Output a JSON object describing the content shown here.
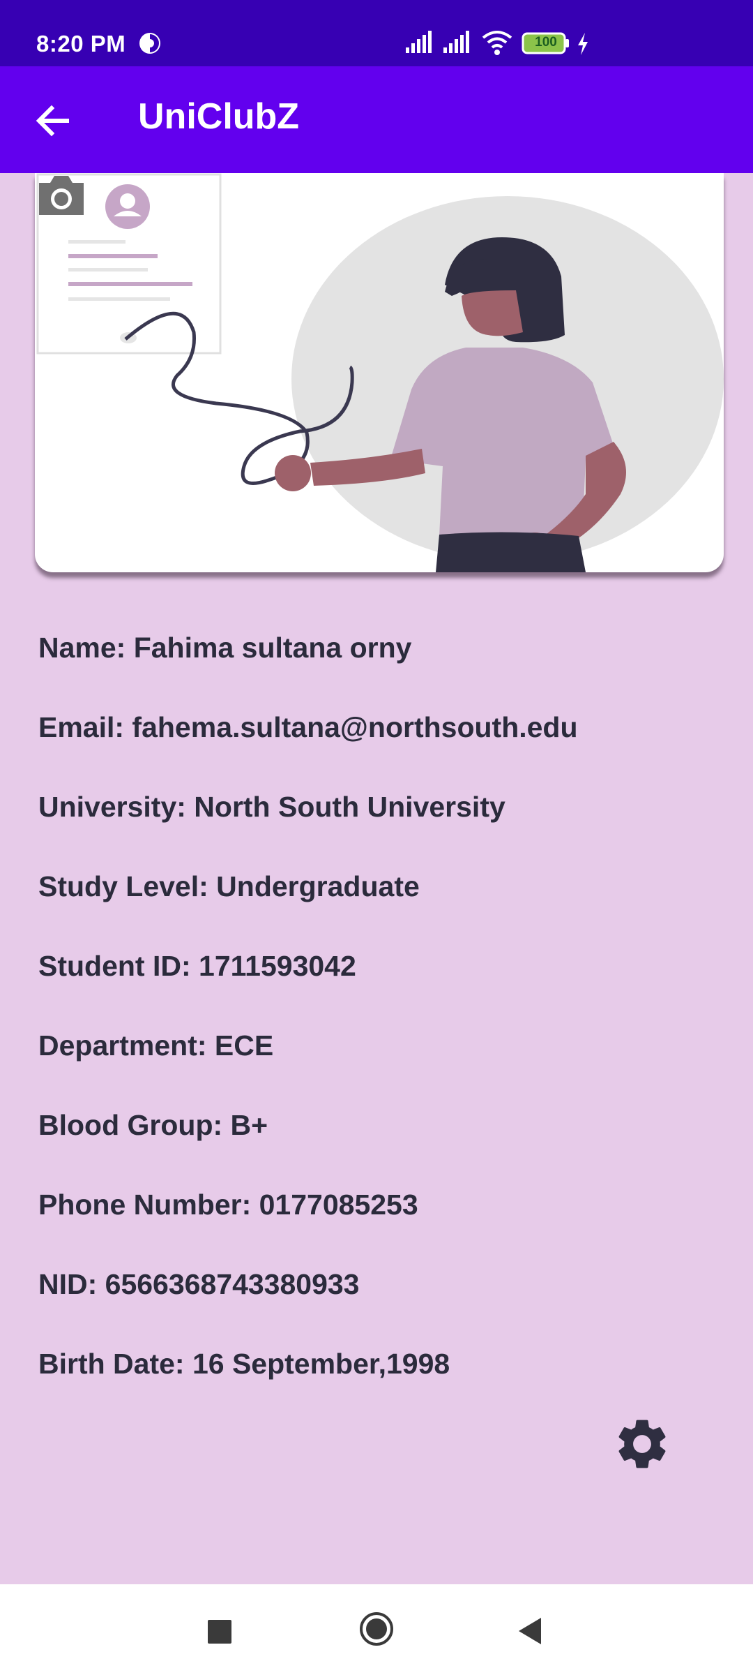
{
  "status_bar": {
    "time": "8:20 PM",
    "battery": "100",
    "icons": [
      "vpn-key-icon",
      "signal-icon",
      "signal-icon",
      "wifi-icon",
      "battery-icon",
      "charging-icon"
    ]
  },
  "app_bar": {
    "title": "UniClubZ",
    "back_icon": "arrow-left-icon"
  },
  "hero": {
    "illustration": "profile-illustration",
    "camera_icon": "camera-icon"
  },
  "profile": [
    {
      "text": "Name: Fahima sultana orny"
    },
    {
      "text": "Email: fahema.sultana@northsouth.edu"
    },
    {
      "text": "University: North South University"
    },
    {
      "text": "Study Level: Undergraduate"
    },
    {
      "text": "Student ID: 1711593042"
    },
    {
      "text": "Department: ECE"
    },
    {
      "text": "Blood Group: B+"
    },
    {
      "text": "Phone Number: 0177085253"
    },
    {
      "text": "NID: 6566368743380933"
    },
    {
      "text": "Birth Date: 16 September,1998"
    }
  ],
  "settings_icon": "gear-icon",
  "nav_bar": {
    "icons": [
      "recents-square-icon",
      "home-circle-icon",
      "back-triangle-icon"
    ]
  },
  "colors": {
    "status_bar": "#3700b3",
    "app_bar": "#6200ee",
    "background": "#e7cbe9",
    "text": "#2b2b3c"
  }
}
